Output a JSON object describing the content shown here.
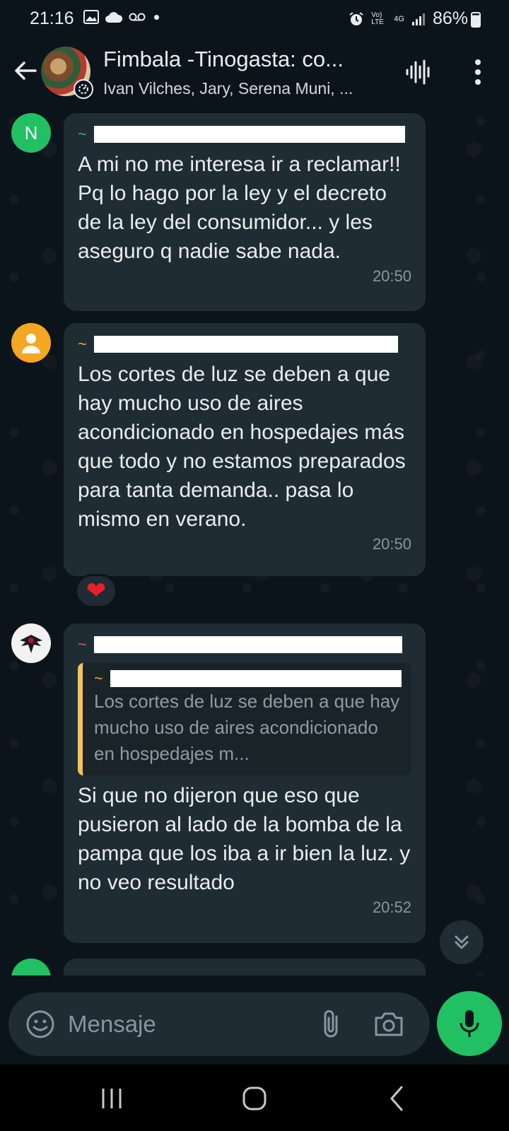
{
  "status_bar": {
    "time": "21:16",
    "network": "Vo) LTE",
    "signal_label": "4G",
    "battery": "86%"
  },
  "header": {
    "title": "Fimbala -Tinogasta: co...",
    "subtitle": "Ivan Vilches, Jary, Serena Muni, ..."
  },
  "messages": [
    {
      "sender_prefix": "~",
      "sender_color": "#21c063",
      "avatar_letter": "N",
      "text": "A mi no me interesa ir a reclamar!! Pq lo hago por la ley y el decreto de la ley del consumidor... y les aseguro q nadie sabe nada.",
      "time": "20:50"
    },
    {
      "sender_prefix": "~",
      "sender_color": "#f5a623",
      "text": "Los cortes de luz se deben a que hay mucho uso de aires acondicionado en hospedajes más  que todo y no estamos preparados para tanta demanda.. pasa lo mismo en verano.",
      "time": "20:50",
      "reaction": "❤"
    },
    {
      "sender_prefix": "~",
      "sender_color": "#e8505b",
      "quote": {
        "sender_prefix": "~",
        "text": "Los cortes de luz se deben a que hay mucho uso de aires acondicionado en hospedajes m..."
      },
      "text": "Si que no dijeron que eso que pusieron al lado de la bomba de la pampa que los iba a ir bien la luz. y no veo resultado",
      "time": "20:52"
    }
  ],
  "composer": {
    "placeholder": "Mensaje"
  },
  "colors": {
    "background": "#0b141a",
    "bubble": "#202c33",
    "accent_green": "#21c063",
    "quote_bar": "#f5c25a"
  },
  "icons": [
    "back-arrow-icon",
    "voice-call-icon",
    "more-vert-icon",
    "emoji-icon",
    "attach-icon",
    "camera-icon",
    "mic-icon",
    "chevron-double-down-icon",
    "heart-icon",
    "user-icon"
  ]
}
